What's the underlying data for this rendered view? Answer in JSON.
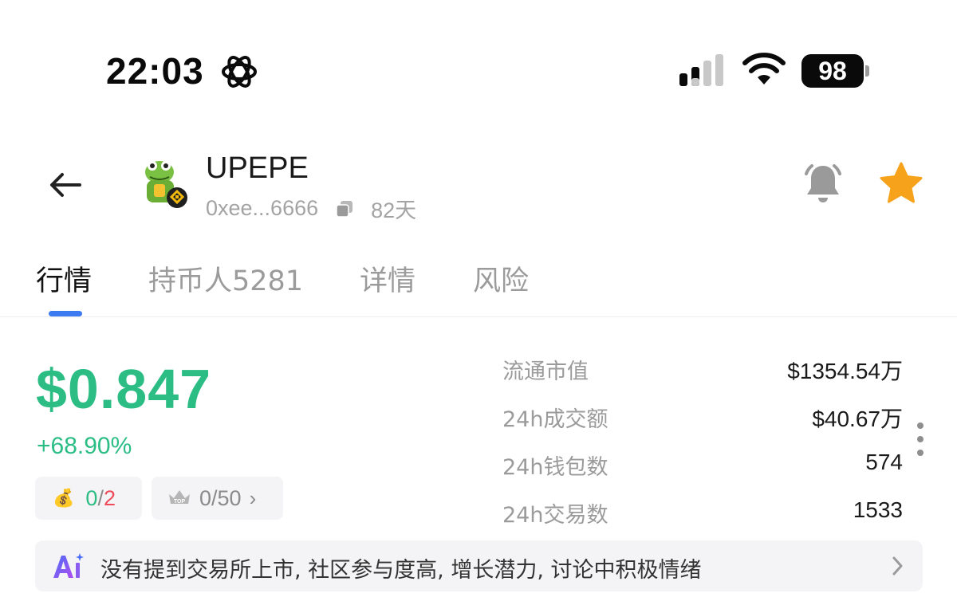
{
  "status_bar": {
    "time": "22:03",
    "battery": "98",
    "icons": [
      "atom-icon",
      "signal-icon",
      "wifi-icon",
      "battery-icon"
    ]
  },
  "header": {
    "token_name": "UPEPE",
    "address": "0xee...6666",
    "age": "82天",
    "icons": [
      "back-arrow-icon",
      "copy-icon",
      "bell-icon",
      "star-icon"
    ],
    "colors": {
      "star": "#f7a21b",
      "bell": "#9a9a9a"
    }
  },
  "tabs": [
    {
      "label": "行情",
      "active": true
    },
    {
      "label": "持币人5281",
      "active": false
    },
    {
      "label": "详情",
      "active": false
    },
    {
      "label": "风险",
      "active": false
    }
  ],
  "price": {
    "value": "$0.847",
    "change": "+68.90%",
    "color": "#2cbd85"
  },
  "chips": {
    "money": {
      "icon": "money-bag-icon",
      "current": "0",
      "sep": "/",
      "total": "2"
    },
    "top": {
      "icon": "crown-top-icon",
      "value": "0/50",
      "chevron": "›"
    }
  },
  "stats": [
    {
      "label": "流通市值",
      "value": "$1354.54万"
    },
    {
      "label": "24h成交额",
      "value": "$40.67万"
    },
    {
      "label": "24h钱包数",
      "value": "574"
    },
    {
      "label": "24h交易数",
      "value": "1533"
    }
  ],
  "ai_banner": {
    "text": "没有提到交易所上市, 社区参与度高, 增长潜力, 讨论中积极情绪",
    "icon": "ai-icon"
  }
}
